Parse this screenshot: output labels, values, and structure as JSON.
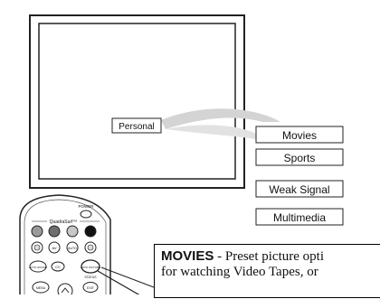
{
  "tv": {
    "current_setting_label": "Personal"
  },
  "picture_options": [
    {
      "label": "Movies"
    },
    {
      "label": "Sports"
    },
    {
      "label": "Weak Signal"
    },
    {
      "label": "Multimedia"
    }
  ],
  "remote": {
    "power_label": "POWER",
    "quadrasurf_label": "QuadraSurf™",
    "button_labels": [
      "AV",
      "AUTO",
      "AUTO SOUND",
      "CC",
      "AUTO PICTURE",
      "STATUS",
      "MENU",
      "EXIT"
    ],
    "highlighted_button": "AUTO PICTURE"
  },
  "caption": {
    "heading": "MOVIES",
    "text_line1": " - Preset picture opti",
    "text_line2": "for watching Video Tapes, or"
  }
}
